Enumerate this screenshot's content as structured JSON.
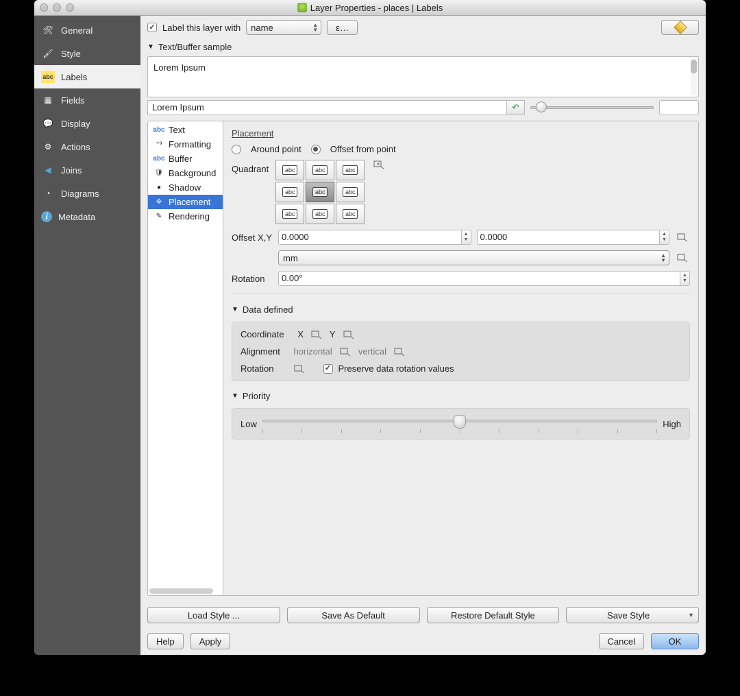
{
  "window": {
    "title": "Layer Properties - places | Labels"
  },
  "sidebar": {
    "items": [
      {
        "label": "General",
        "icon": "tools"
      },
      {
        "label": "Style",
        "icon": "brush"
      },
      {
        "label": "Labels",
        "icon": "abc",
        "selected": true
      },
      {
        "label": "Fields",
        "icon": "table"
      },
      {
        "label": "Display",
        "icon": "tip"
      },
      {
        "label": "Actions",
        "icon": "gear"
      },
      {
        "label": "Joins",
        "icon": "join"
      },
      {
        "label": "Diagrams",
        "icon": "pie"
      },
      {
        "label": "Metadata",
        "icon": "info"
      }
    ]
  },
  "top": {
    "check": "Label this layer with",
    "field_selected": "name",
    "expr_btn": "ε…"
  },
  "sample": {
    "header": "Text/Buffer sample",
    "preview": "Lorem Ipsum",
    "text_value": "Lorem Ipsum"
  },
  "subtabs": [
    {
      "label": "Text",
      "icon": "abc"
    },
    {
      "label": "Formatting",
      "icon": "fmt"
    },
    {
      "label": "Buffer",
      "icon": "abc"
    },
    {
      "label": "Background",
      "icon": "shield"
    },
    {
      "label": "Shadow",
      "icon": "ball"
    },
    {
      "label": "Placement",
      "icon": "arrows",
      "selected": true
    },
    {
      "label": "Rendering",
      "icon": "pen"
    }
  ],
  "placement": {
    "title": "Placement",
    "radio1": "Around point",
    "radio2": "Offset from point",
    "radio_sel": 2,
    "quadrant_label": "Quadrant",
    "quadrant_sel": 4,
    "offset_label": "Offset X,Y",
    "offset_x": "0.0000",
    "offset_y": "0.0000",
    "unit": "mm",
    "rotation_label": "Rotation",
    "rotation_value": "0.00°"
  },
  "datadefined": {
    "title": "Data defined",
    "coord": "Coordinate",
    "x": "X",
    "y": "Y",
    "alignment": "Alignment",
    "horiz": "horizontal",
    "vert": "vertical",
    "rotation": "Rotation",
    "preserve": "Preserve data rotation values"
  },
  "priority": {
    "title": "Priority",
    "low": "Low",
    "high": "High",
    "value": 0.5
  },
  "footer": {
    "load": "Load Style ...",
    "save_def": "Save As Default",
    "restore": "Restore Default Style",
    "save": "Save Style",
    "help": "Help",
    "apply": "Apply",
    "cancel": "Cancel",
    "ok": "OK"
  }
}
